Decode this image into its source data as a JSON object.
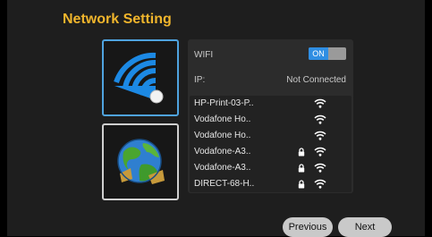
{
  "title": "Network Setting",
  "modes": [
    {
      "name": "wifi",
      "icon": "wifi-signal-icon",
      "selected": true
    },
    {
      "name": "ethernet",
      "icon": "globe-network-icon",
      "selected": false
    }
  ],
  "wifi": {
    "label": "WIFI",
    "toggle": "ON",
    "enabled": true
  },
  "ip": {
    "label": "IP:",
    "value": "Not Connected"
  },
  "networks": [
    {
      "name": "HP-Print-03-P..",
      "locked": false
    },
    {
      "name": "Vodafone Ho..",
      "locked": false
    },
    {
      "name": "Vodafone Ho..",
      "locked": false
    },
    {
      "name": "Vodafone-A3..",
      "locked": true
    },
    {
      "name": "Vodafone-A3..",
      "locked": true
    },
    {
      "name": "DIRECT-68-H..",
      "locked": true
    }
  ],
  "buttons": {
    "previous": "Previous",
    "next": "Next"
  },
  "colors": {
    "title": "#f0b52c",
    "accent": "#2f8ee3",
    "selected_border": "#4fa3df"
  }
}
